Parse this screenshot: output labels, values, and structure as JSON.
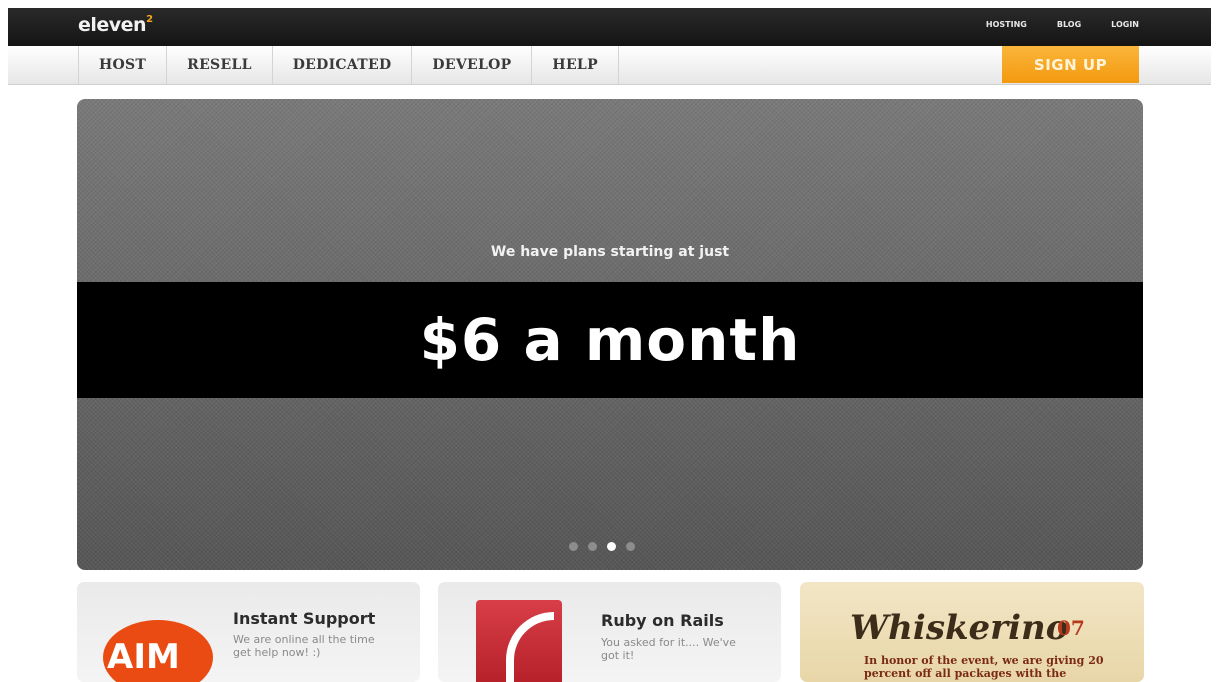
{
  "brand": {
    "name": "eleven",
    "superscript": "2",
    "accent_color": "#f4a621"
  },
  "top_links": [
    "HOSTING",
    "BLOG",
    "LOGIN"
  ],
  "nav": {
    "items": [
      "HOST",
      "RESELL",
      "DEDICATED",
      "DEVELOP",
      "HELP"
    ],
    "signup_label": "SIGN UP"
  },
  "hero": {
    "subtitle": "We have plans starting at just",
    "price": "$6 a month",
    "slides": 4,
    "active_slide": 3
  },
  "cards": [
    {
      "title": "Instant Support",
      "description": "We are online all the time get help now! :)",
      "icon": "aim-icon",
      "icon_text": "AIM"
    },
    {
      "title": "Ruby on Rails",
      "description": "You asked for it.... We've got it!",
      "icon": "rails-icon"
    },
    {
      "title": "Whiskerino",
      "number": "07",
      "description": "In honor of the event, we are giving 20 percent off all packages with the"
    }
  ]
}
